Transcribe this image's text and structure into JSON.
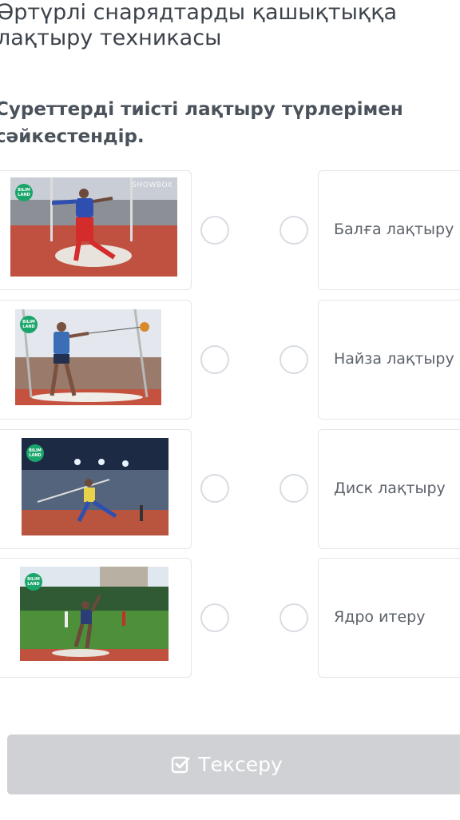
{
  "header": {
    "title_line1": "Әртүрлі снарядтарды қашықтыққа",
    "title_line2": "лақтыру техникасы"
  },
  "task": {
    "instruction_line1": "Суреттерді тиісті лақтыру түрлерімен",
    "instruction_line2": "сәйкестендір."
  },
  "images": {
    "logo_text": "BILIM LAND",
    "brand_watermark": "SHOWBOX"
  },
  "answers": [
    {
      "label": "Балға лақтыру"
    },
    {
      "label": "Найза лақтыру"
    },
    {
      "label": "Диск лақтыру"
    },
    {
      "label": "Ядро итеру"
    }
  ],
  "actions": {
    "check_label": "Тексеру",
    "check_icon": "checkbox-check-icon"
  },
  "colors": {
    "logo_green": "#1aa56a",
    "button_disabled": "#cfd1d4",
    "radio_border": "#d8dce1"
  }
}
